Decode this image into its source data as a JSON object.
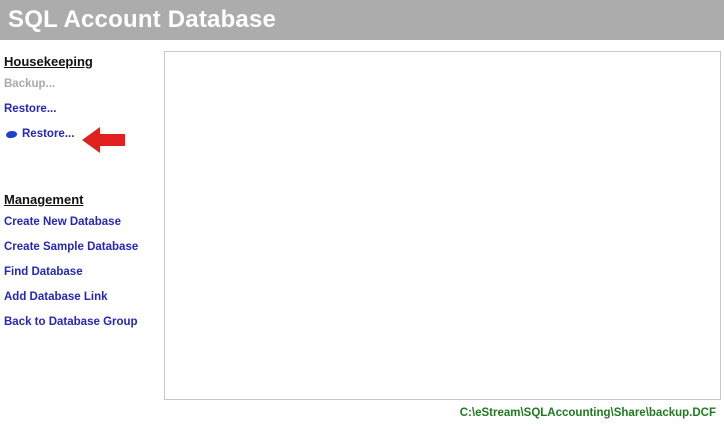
{
  "app": {
    "title": "SQL Account Database"
  },
  "sidebar": {
    "housekeeping": {
      "heading": "Housekeeping",
      "items": [
        {
          "label": "Backup...",
          "enabled": false
        },
        {
          "label": "Restore...",
          "enabled": true
        },
        {
          "label": "Restore...",
          "enabled": true,
          "icon": "blob-icon"
        }
      ]
    },
    "management": {
      "heading": "Management",
      "items": [
        {
          "label": "Create New Database"
        },
        {
          "label": "Create Sample Database"
        },
        {
          "label": "Find Database"
        },
        {
          "label": "Add Database Link"
        },
        {
          "label": "Back to Database Group"
        }
      ]
    }
  },
  "annotation": {
    "icon": "red-arrow-left-icon",
    "color": "#e0201c"
  },
  "status": {
    "path": "C:\\eStream\\SQLAccounting\\Share\\backup.DCF",
    "color": "#1e7a1e"
  },
  "colors": {
    "title_bar": "#acacac",
    "link": "#2626b8",
    "disabled_link": "#a9a9a9"
  }
}
